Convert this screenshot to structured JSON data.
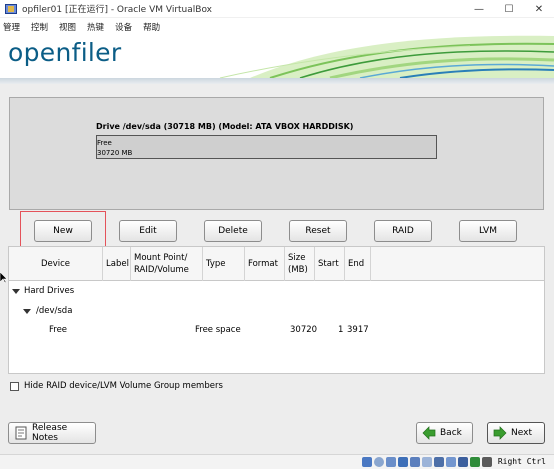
{
  "window": {
    "title": "opfiler01 [正在运行] - Oracle VM VirtualBox",
    "minimize": "—",
    "maximize": "☐",
    "close": "✕"
  },
  "menu": {
    "items": [
      "管理",
      "控制",
      "视图",
      "热键",
      "设备",
      "帮助"
    ]
  },
  "header": {
    "logo": "openfiler"
  },
  "drive": {
    "title": "Drive /dev/sda (30718 MB) (Model: ATA VBOX HARDDISK)",
    "segment_label": "Free",
    "segment_size": "30720 MB"
  },
  "toolbar": {
    "new": "New",
    "edit": "Edit",
    "delete": "Delete",
    "reset": "Reset",
    "raid": "RAID",
    "lvm": "LVM"
  },
  "table": {
    "headers": {
      "device": "Device",
      "label": "Label",
      "mount_line1": "Mount Point/",
      "mount_line2": "RAID/Volume",
      "type": "Type",
      "format": "Format",
      "size_line1": "Size",
      "size_line2": "(MB)",
      "start": "Start",
      "end": "End"
    },
    "tree": {
      "group": "Hard Drives",
      "disk": "/dev/sda",
      "row": {
        "device": "Free",
        "type": "Free space",
        "size": "30720",
        "start": "1",
        "end": "3917"
      }
    }
  },
  "options": {
    "hide_raid_lvm": "Hide RAID device/LVM Volume Group members",
    "hide_checked": false
  },
  "footer": {
    "release_notes": "Release Notes",
    "back": "Back",
    "next": "Next"
  },
  "statusbar": {
    "host_key": "Right Ctrl"
  },
  "colors": {
    "logo": "#0b5d86",
    "highlight": "#e4525a",
    "arrow_green": "#3a9d2f"
  }
}
